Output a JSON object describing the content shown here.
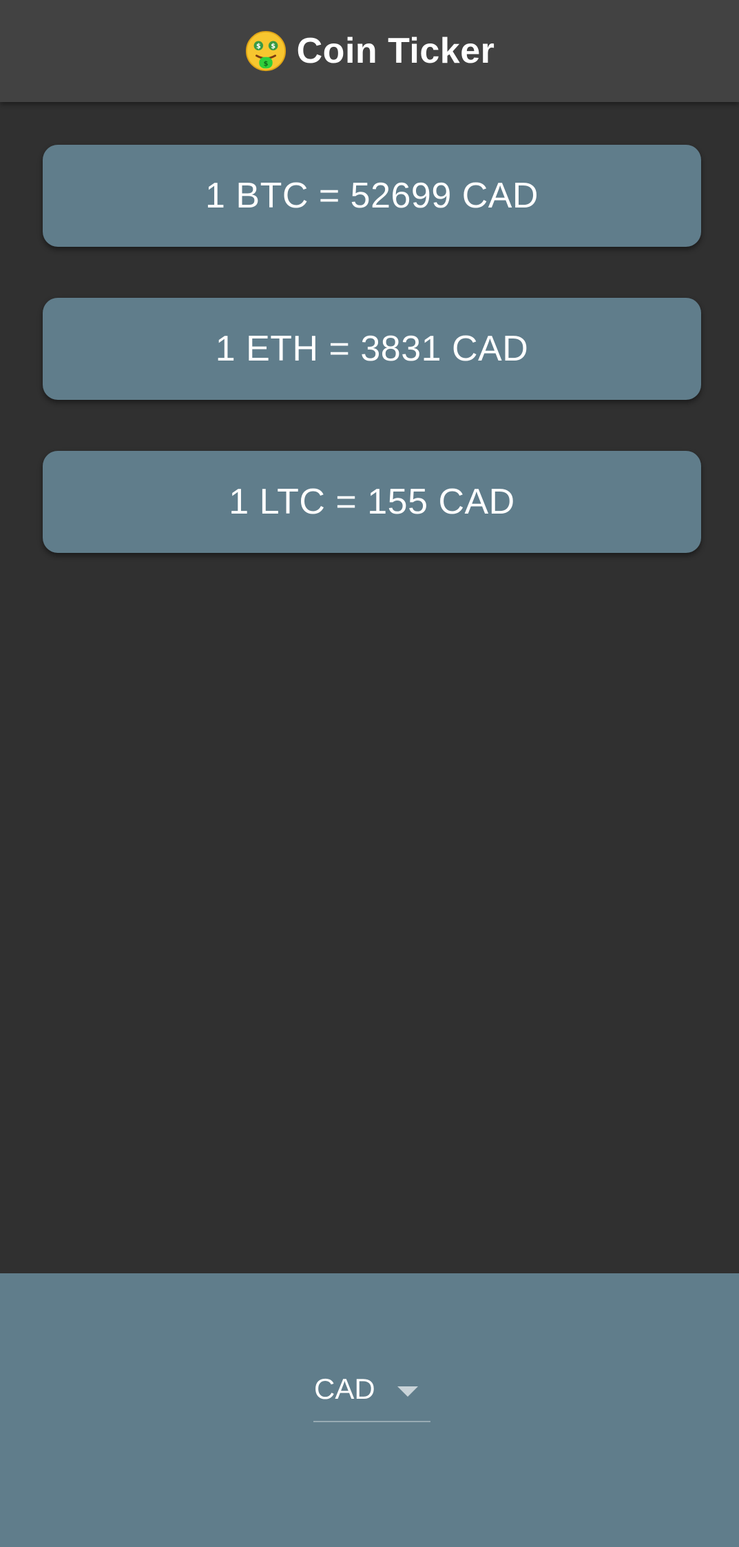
{
  "app_bar": {
    "icon": "money-mouth-face-icon",
    "title": "Coin Ticker"
  },
  "rates": [
    {
      "label": "1 BTC = 52699 CAD"
    },
    {
      "label": "1 ETH = 3831 CAD"
    },
    {
      "label": "1 LTC = 155 CAD"
    }
  ],
  "currency_picker": {
    "selected": "CAD",
    "icon": "dropdown-arrow-icon"
  },
  "colors": {
    "background": "#303030",
    "app_bar": "#424242",
    "card": "#607d8b",
    "bottom_panel": "#607d8b",
    "text": "#ffffff"
  }
}
